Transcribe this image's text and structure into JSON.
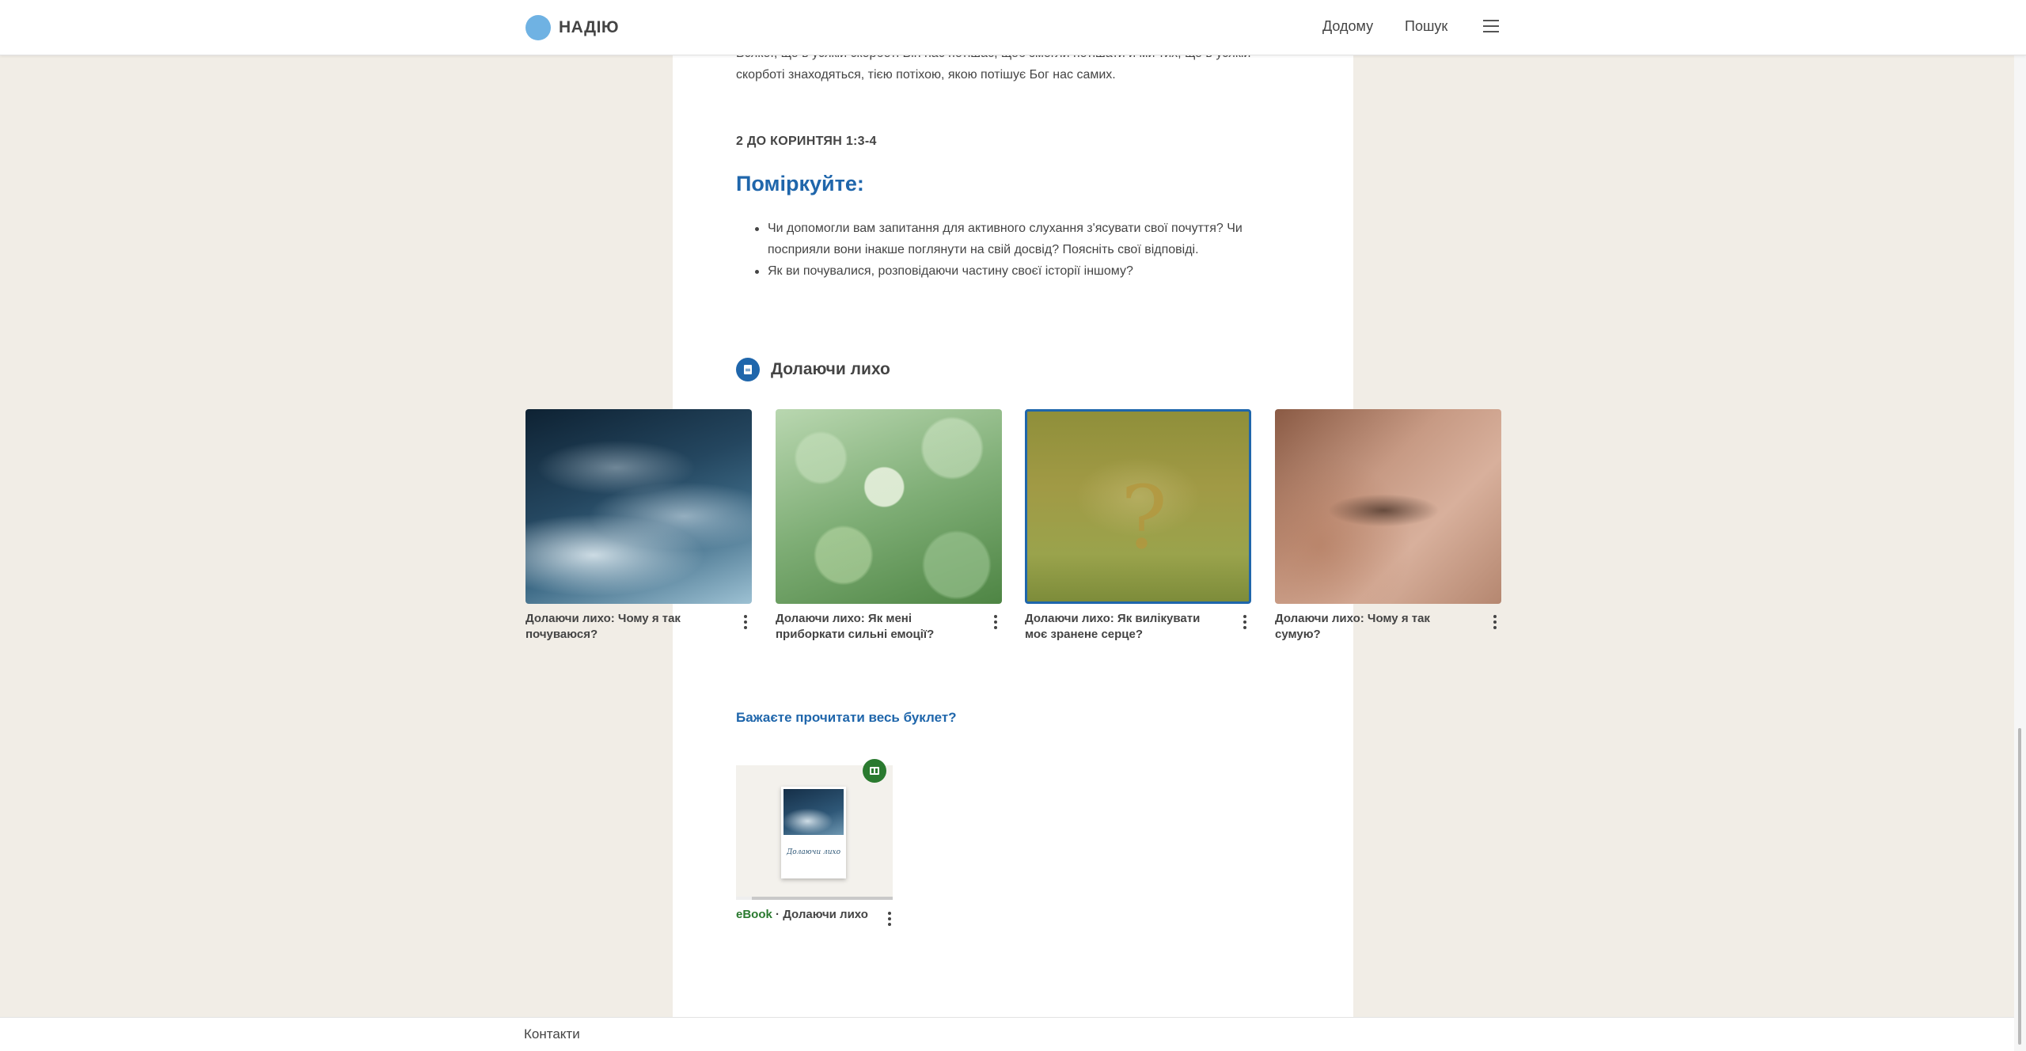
{
  "header": {
    "logo_text": "НАДІЮ",
    "nav": {
      "home": "Додому",
      "search": "Пошук"
    },
    "menu_icon": "hamburger-menu-icon"
  },
  "article": {
    "prev_paragraph": "Всякої, що в усякій скорботі Він нас потішає, щоб змогли потішати й ми тих, що в усякій скорботі знаходяться, тією потіхою, якою потішує Бог нас самих.",
    "scripture_reference": "2 ДО КОРИНТЯН 1:3-4",
    "reflect_heading": "Поміркуйте:",
    "reflect_questions": [
      "Чи допомогли вам запитання для активного слухання з'ясувати свої почуття? Чи посприяли вони інакше поглянути на свій досвід? Поясніть свої відповіді.",
      "Як ви почувалися, розповідаючи частину своєї історії іншому?"
    ]
  },
  "series": {
    "icon": "document-icon",
    "title": "Долаючи лихо",
    "items": [
      {
        "title": "Долаючи лихо: Чому я так почуваюся?",
        "image": "ocean-waves",
        "active": false
      },
      {
        "title": "Долаючи лихо: Як мені приборкати сильні емоції?",
        "image": "green-bokeh",
        "active": false
      },
      {
        "title": "Долаючи лихо: Як вилікувати моє зранене серце?",
        "image": "question-mark-on-glass",
        "active": true
      },
      {
        "title": "Долаючи лихо: Чому я так сумую?",
        "image": "closed-eye-freckles",
        "active": false
      }
    ]
  },
  "booklet": {
    "link_text": "Бажаєте прочитати весь буклет?",
    "ebook": {
      "kind": "eBook",
      "separator": " · ",
      "title": "Долаючи лихо",
      "cover_title": "Долаючи лихо",
      "badge_icon": "book-icon",
      "progress": 0.1
    }
  },
  "footer": {
    "contacts": "Контакти"
  },
  "colors": {
    "accent": "#1f66ab",
    "ebook_green": "#2a7a2f",
    "page_bg": "#f1ede6"
  }
}
